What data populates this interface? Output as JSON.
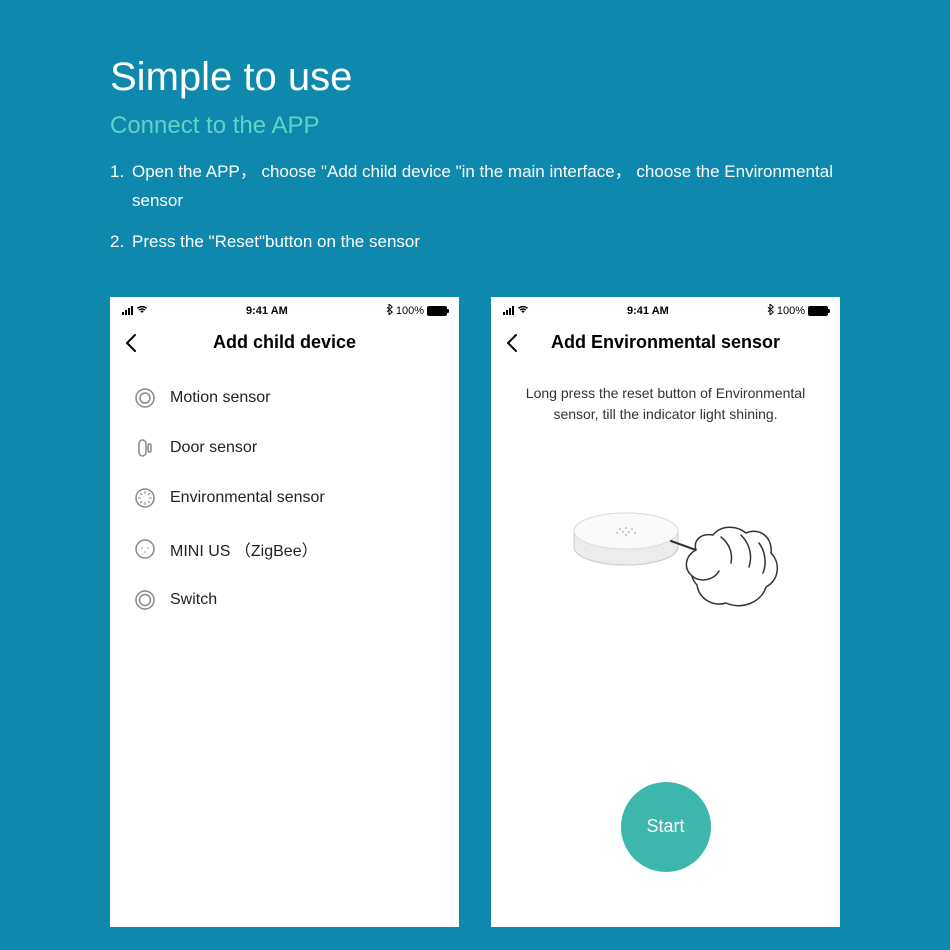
{
  "header": {
    "title": "Simple to use",
    "subtitle": "Connect to the APP",
    "step1_num": "1.",
    "step1_text": "Open the APP， choose \"Add child device \"in the main interface， choose the Environmental sensor",
    "step2_num": "2.",
    "step2_text": "Press the \"Reset\"button on the sensor"
  },
  "status": {
    "time": "9:41 AM",
    "battery_pct": "100%"
  },
  "phone1": {
    "nav_title": "Add child device",
    "items": [
      {
        "label": "Motion sensor"
      },
      {
        "label": "Door sensor"
      },
      {
        "label": "Environmental sensor"
      },
      {
        "label": "MINI US （ZigBee）"
      },
      {
        "label": "Switch"
      }
    ]
  },
  "phone2": {
    "nav_title": "Add Environmental sensor",
    "instruction": "Long press the reset button of Environmental sensor, till the indicator light shining.",
    "start_label": "Start"
  }
}
